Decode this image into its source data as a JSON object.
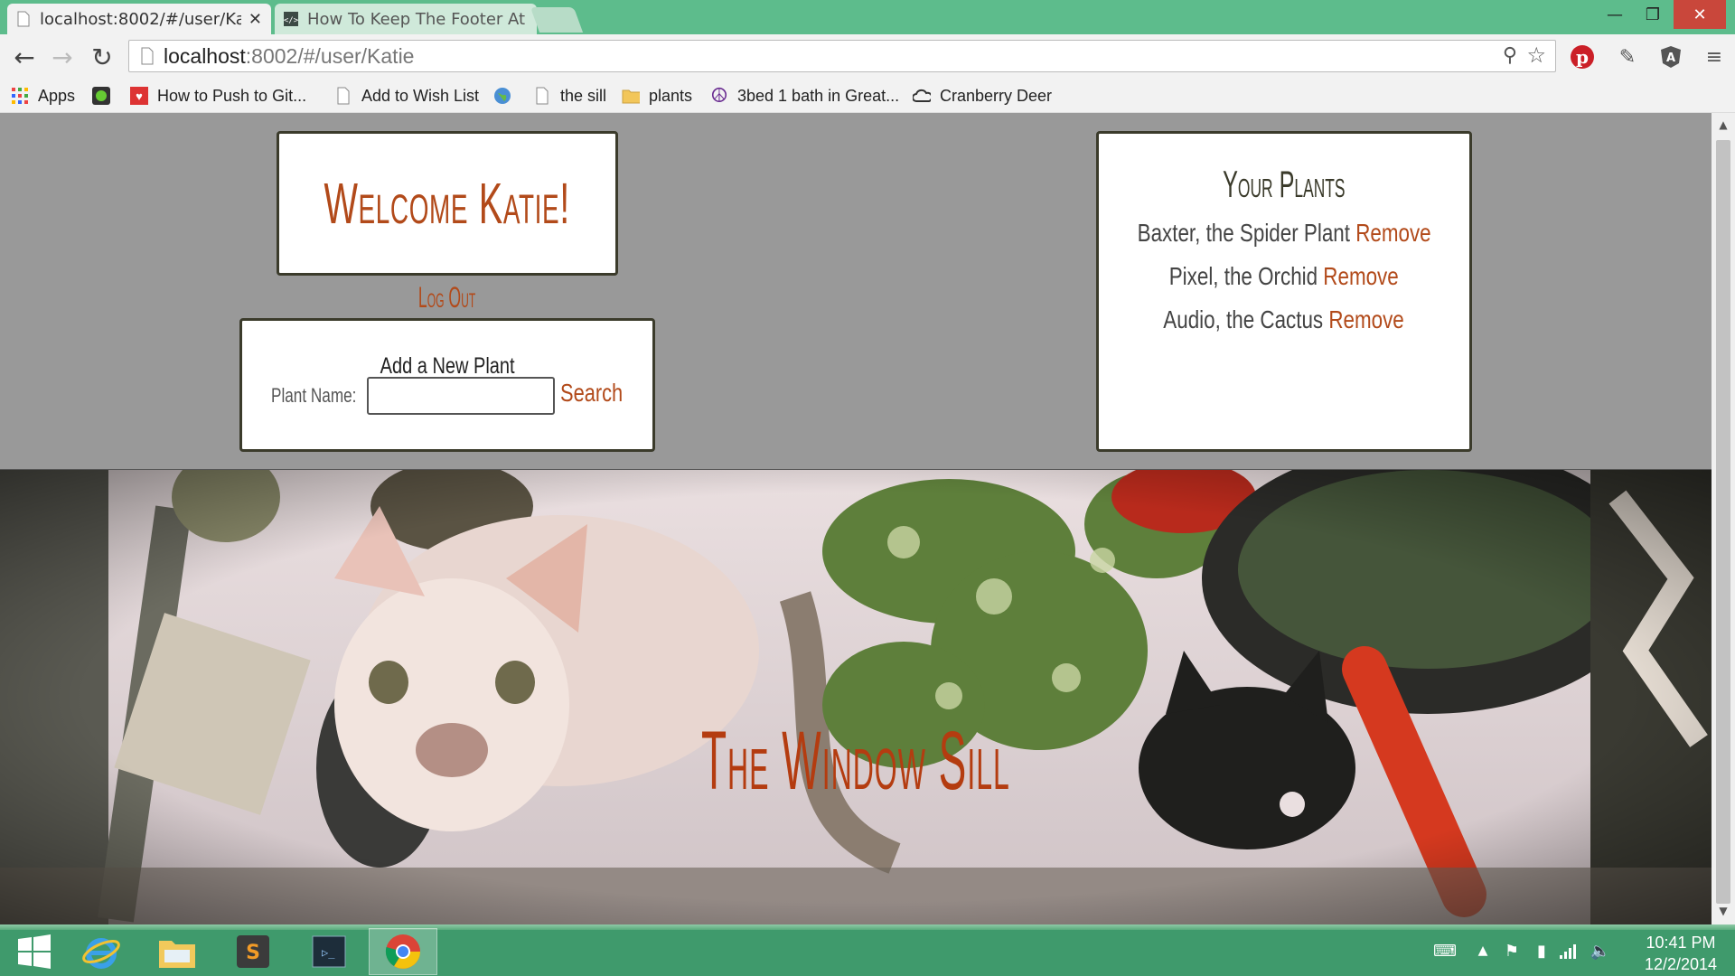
{
  "browser": {
    "tabs": [
      {
        "label": "localhost:8002/#/user/Katie",
        "active": true
      },
      {
        "label": "How To Keep The Footer At",
        "active": false
      }
    ],
    "url_host": "localhost",
    "url_rest": ":8002/#/user/Katie",
    "bookmarks": [
      {
        "label": "Apps",
        "icon": "apps-grid-icon"
      },
      {
        "label": "",
        "icon": "green-app-icon"
      },
      {
        "label": "How to Push to Git...",
        "icon": "heart-shield-icon"
      },
      {
        "label": "Add to Wish List",
        "icon": "page-icon"
      },
      {
        "label": "",
        "icon": "globe-icon"
      },
      {
        "label": "the sill",
        "icon": "page-icon"
      },
      {
        "label": "plants",
        "icon": "folder-icon"
      },
      {
        "label": "3bed 1 bath in Great...",
        "icon": "peace-icon"
      },
      {
        "label": "Cranberry Deer",
        "icon": "cloud-icon"
      }
    ]
  },
  "page": {
    "welcome_title": "Welcome Katie!",
    "logout_label": "Log Out",
    "add_plant": {
      "title": "Add a New Plant",
      "label": "Plant Name:",
      "input_value": "",
      "button_label": "Search"
    },
    "plants": {
      "title": "Your Plants",
      "remove_label": "Remove",
      "items": [
        {
          "name": "Baxter, the Spider Plant"
        },
        {
          "name": "Pixel, the Orchid"
        },
        {
          "name": "Audio, the Cactus"
        }
      ]
    },
    "hero_title": "The Window Sill"
  },
  "taskbar": {
    "time": "10:41 PM",
    "date": "12/2/2014"
  },
  "colors": {
    "accent": "#b24a1a",
    "chrome_frame": "#5dbc8c",
    "taskbar": "#3f9a6c",
    "page_bg": "#999999"
  }
}
